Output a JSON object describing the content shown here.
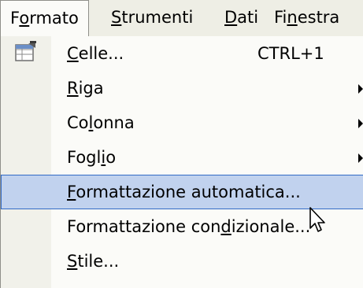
{
  "menubar": {
    "items": [
      {
        "pre": "F",
        "u": "o",
        "post": "rmato"
      },
      {
        "pre": "",
        "u": "S",
        "post": "trumenti"
      },
      {
        "pre": "",
        "u": "D",
        "post": "ati"
      },
      {
        "pre": "Fi",
        "u": "n",
        "post": "estra"
      }
    ]
  },
  "menu": {
    "items": [
      {
        "pre": "",
        "u": "C",
        "post": "elle...",
        "shortcut": "CTRL+1",
        "icon": "format-cells-icon"
      },
      {
        "pre": "",
        "u": "R",
        "post": "iga",
        "submenu": true
      },
      {
        "pre": "Co",
        "u": "l",
        "post": "onna",
        "submenu": true
      },
      {
        "pre": "Fogl",
        "u": "i",
        "post": "o",
        "submenu": true
      },
      {
        "pre": "",
        "u": "F",
        "post": "ormattazione automatica...",
        "highlighted": true
      },
      {
        "pre": "Formattazione con",
        "u": "d",
        "post": "izionale..."
      },
      {
        "pre": "",
        "u": "S",
        "post": "tile..."
      }
    ]
  },
  "colors": {
    "menubar_bg": "#eeeee5",
    "menu_bg": "#fbfbf8",
    "gutter_bg": "#f1f1ea",
    "highlight_bg": "#c1d2ee",
    "highlight_border": "#316ac5"
  },
  "cursor": "arrow-pointer-icon"
}
